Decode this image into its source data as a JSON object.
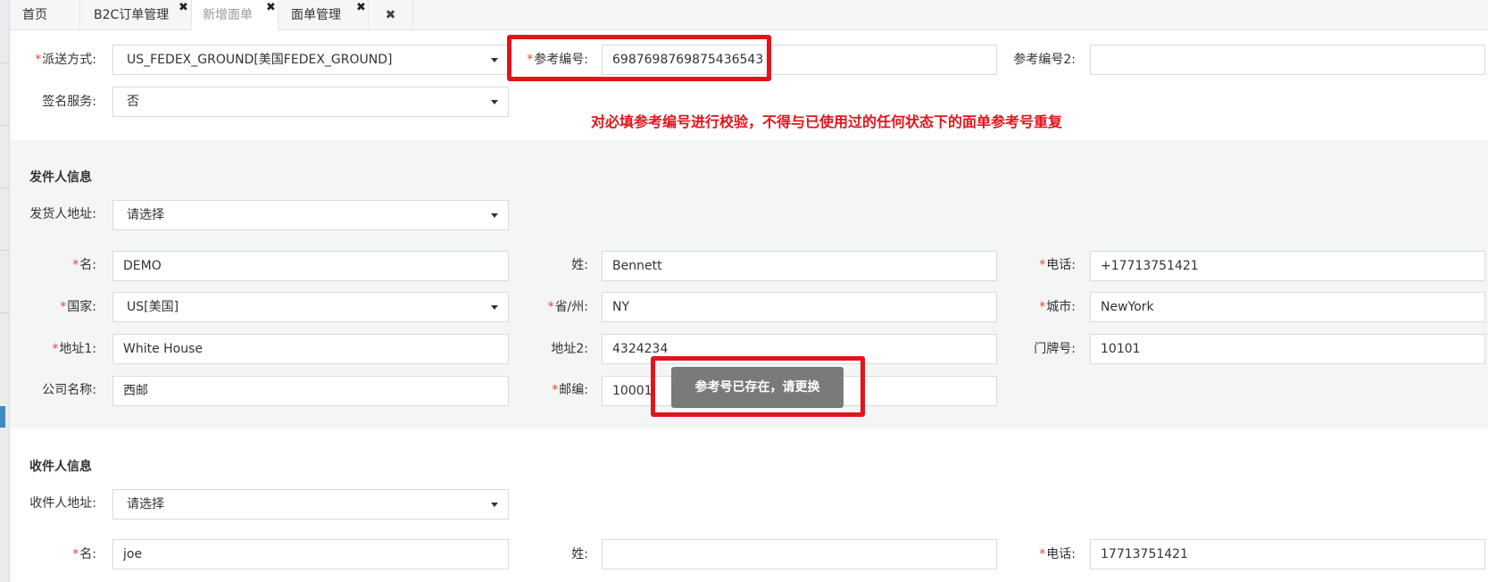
{
  "tabs": [
    {
      "label": "首页",
      "closable": false,
      "active": false
    },
    {
      "label": "B2C订单管理",
      "closable": true,
      "active": false
    },
    {
      "label": "新增面单",
      "closable": true,
      "active": true
    },
    {
      "label": "面单管理",
      "closable": true,
      "active": false
    }
  ],
  "close_all_glyph": "✖",
  "close_glyph": "✖",
  "required_mark": "*",
  "caret_icon": "caret-down-icon",
  "shipping": {
    "delivery_label": "派送方式:",
    "delivery_value": "US_FEDEX_GROUND[美国FEDEX_GROUND]",
    "ref_label": "参考编号:",
    "ref_value": "6987698769875436543",
    "ref2_label": "参考编号2:",
    "ref2_value": "",
    "sign_label": "签名服务:",
    "sign_value": "否"
  },
  "annotation": {
    "note": "对必填参考编号进行校验，不得与已使用过的任何状态下的面单参考号重复",
    "box_color": "#e4131b"
  },
  "sender": {
    "title": "发件人信息",
    "address_label": "发货人地址:",
    "address_value": "请选择",
    "first_name_label": "名:",
    "first_name_value": "DEMO",
    "last_name_label": "姓:",
    "last_name_value": "Bennett",
    "phone_label": "电话:",
    "phone_value": "+17713751421",
    "country_label": "国家:",
    "country_value": "US[美国]",
    "state_label": "省/州:",
    "state_value": "NY",
    "city_label": "城市:",
    "city_value": "NewYork",
    "addr1_label": "地址1:",
    "addr1_value": "White House",
    "addr2_label": "地址2:",
    "addr2_value": "4324234",
    "door_label": "门牌号:",
    "door_value": "10101",
    "company_label": "公司名称:",
    "company_value": "西邮",
    "zip_label": "邮编:",
    "zip_value": "10001"
  },
  "toast": {
    "message": "参考号已存在，请更换"
  },
  "receiver": {
    "title": "收件人信息",
    "address_label": "收件人地址:",
    "address_value": "请选择",
    "first_name_label": "名:",
    "first_name_value": "joe",
    "last_name_label": "姓:",
    "last_name_value": "",
    "phone_label": "电话:",
    "phone_value": "17713751421"
  },
  "colors": {
    "required": "#e5433a",
    "annotation": "#e4131b",
    "toast_bg": "#7a7a7a",
    "section_bg": "#f3f6f5",
    "accent": "#3c8dbc"
  }
}
